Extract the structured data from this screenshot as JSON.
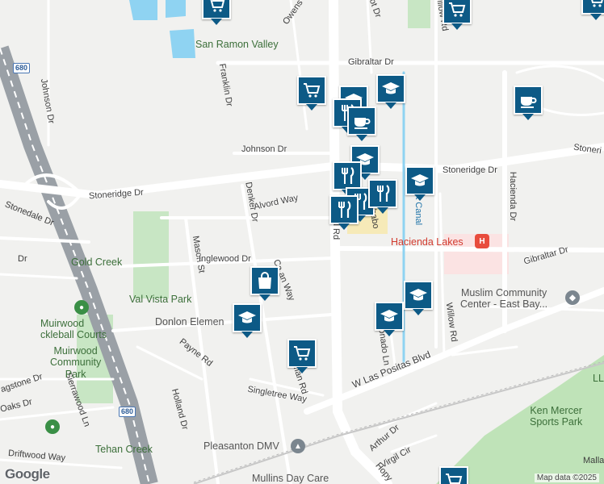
{
  "streets": {
    "owens": "Owens Dr",
    "gibraltar_top": "Gibraltar Dr",
    "johnson_dr_left": "Johnson Dr",
    "johnson_dr_mid": "Johnson Dr",
    "stoneridge_left": "Stoneridge Dr",
    "stoneridge_mid": "Stoneridge Dr",
    "stoneridge_right": "Stoneri",
    "franklin": "Franklin Dr",
    "denker": "Denker Dr",
    "alvord": "Alvord Way",
    "stonedale": "Stonedale Dr",
    "mason": "Mason St",
    "inglewood": "Inglewood Dr",
    "chabot_mid": "Chabo",
    "hacienda_dr": "Hacienda Dr",
    "gibraltar_right": "Gibraltar Dr",
    "willow": "Willow Rd",
    "coronado": "Coronado Ln",
    "payne": "Payne Rd",
    "dorman": "Dorman Rd",
    "flagstone": "agstone Dr",
    "sierrawood": "Sierrawood Ln",
    "oaks": "Oaks Dr",
    "holland": "Holland Dr",
    "singletree": "Singletree Way",
    "w_las_positas": "W Las Positas Blvd",
    "arthur": "Arthur Dr",
    "virgil": "Virgil Cir",
    "driftwood": "Driftwood Way",
    "hopyard": "Hopy",
    "rd_main": "d Rd",
    "canal": "oot Canal",
    "chabot_top": "bot Dr",
    "callaway": "Ca        an Way",
    "mallard": "Malla",
    "willow_top": "illow Rd",
    "wwy_left": "Dr"
  },
  "places": {
    "san_ramon_valley": "San Ramon Valley",
    "gold_creek": "Gold Creek",
    "val_vista_park": "Val Vista Park",
    "muirwood_pickleball": "Muirwood Pickleball Courts",
    "muirwood_pickleball_l1": "Muirwood",
    "muirwood_pickleball_l2": "ckleball Courts",
    "muirwood_park_l1": "Muirwood",
    "muirwood_park_l2": "Community",
    "muirwood_park_l3": "Park",
    "donlon": "Donlon Elemen",
    "hacienda_lakes": "Hacienda Lakes",
    "muslim_center_l1": "Muslim Community",
    "muslim_center_l2": "Center - East Bay...",
    "ken_mercer_l1": "Ken Mercer",
    "ken_mercer_l2": "Sports Park",
    "pleasanton_dmv": "Pleasanton DMV",
    "tehan_creek": "Tehan Creek",
    "mullins": "Mullins Day Care",
    "ll": "LL"
  },
  "highway": {
    "shield_680a": "680",
    "shield_680b": "680"
  },
  "markers": [
    {
      "kind": "grocery",
      "icon": "shopping-cart-icon"
    },
    {
      "kind": "grocery",
      "icon": "shopping-cart-icon"
    },
    {
      "kind": "grocery",
      "icon": "shopping-cart-icon"
    },
    {
      "kind": "grocery",
      "icon": "shopping-cart-icon"
    },
    {
      "kind": "grocery",
      "icon": "shopping-cart-icon"
    },
    {
      "kind": "grocery",
      "icon": "shopping-cart-icon"
    },
    {
      "kind": "school",
      "icon": "graduation-cap-icon"
    },
    {
      "kind": "school",
      "icon": "graduation-cap-icon"
    },
    {
      "kind": "school",
      "icon": "graduation-cap-icon"
    },
    {
      "kind": "school",
      "icon": "graduation-cap-icon"
    },
    {
      "kind": "school",
      "icon": "graduation-cap-icon"
    },
    {
      "kind": "school",
      "icon": "graduation-cap-icon"
    },
    {
      "kind": "school",
      "icon": "graduation-cap-icon"
    },
    {
      "kind": "restaurant",
      "icon": "fork-knife-icon"
    },
    {
      "kind": "restaurant",
      "icon": "fork-knife-icon"
    },
    {
      "kind": "restaurant",
      "icon": "fork-knife-icon"
    },
    {
      "kind": "restaurant",
      "icon": "fork-knife-icon"
    },
    {
      "kind": "restaurant",
      "icon": "fork-knife-icon"
    },
    {
      "kind": "cafe",
      "icon": "coffee-cup-icon"
    },
    {
      "kind": "cafe",
      "icon": "coffee-cup-icon"
    },
    {
      "kind": "shopping",
      "icon": "shopping-bag-icon"
    }
  ],
  "footer": {
    "google": "Google",
    "attribution": "Map data ©2025"
  },
  "colors": {
    "marker": "#0d5a86",
    "park": "#c8e6c4",
    "water": "#8fd3f2",
    "hospital": "#e84c3d",
    "highway": "#9aa0a6"
  }
}
